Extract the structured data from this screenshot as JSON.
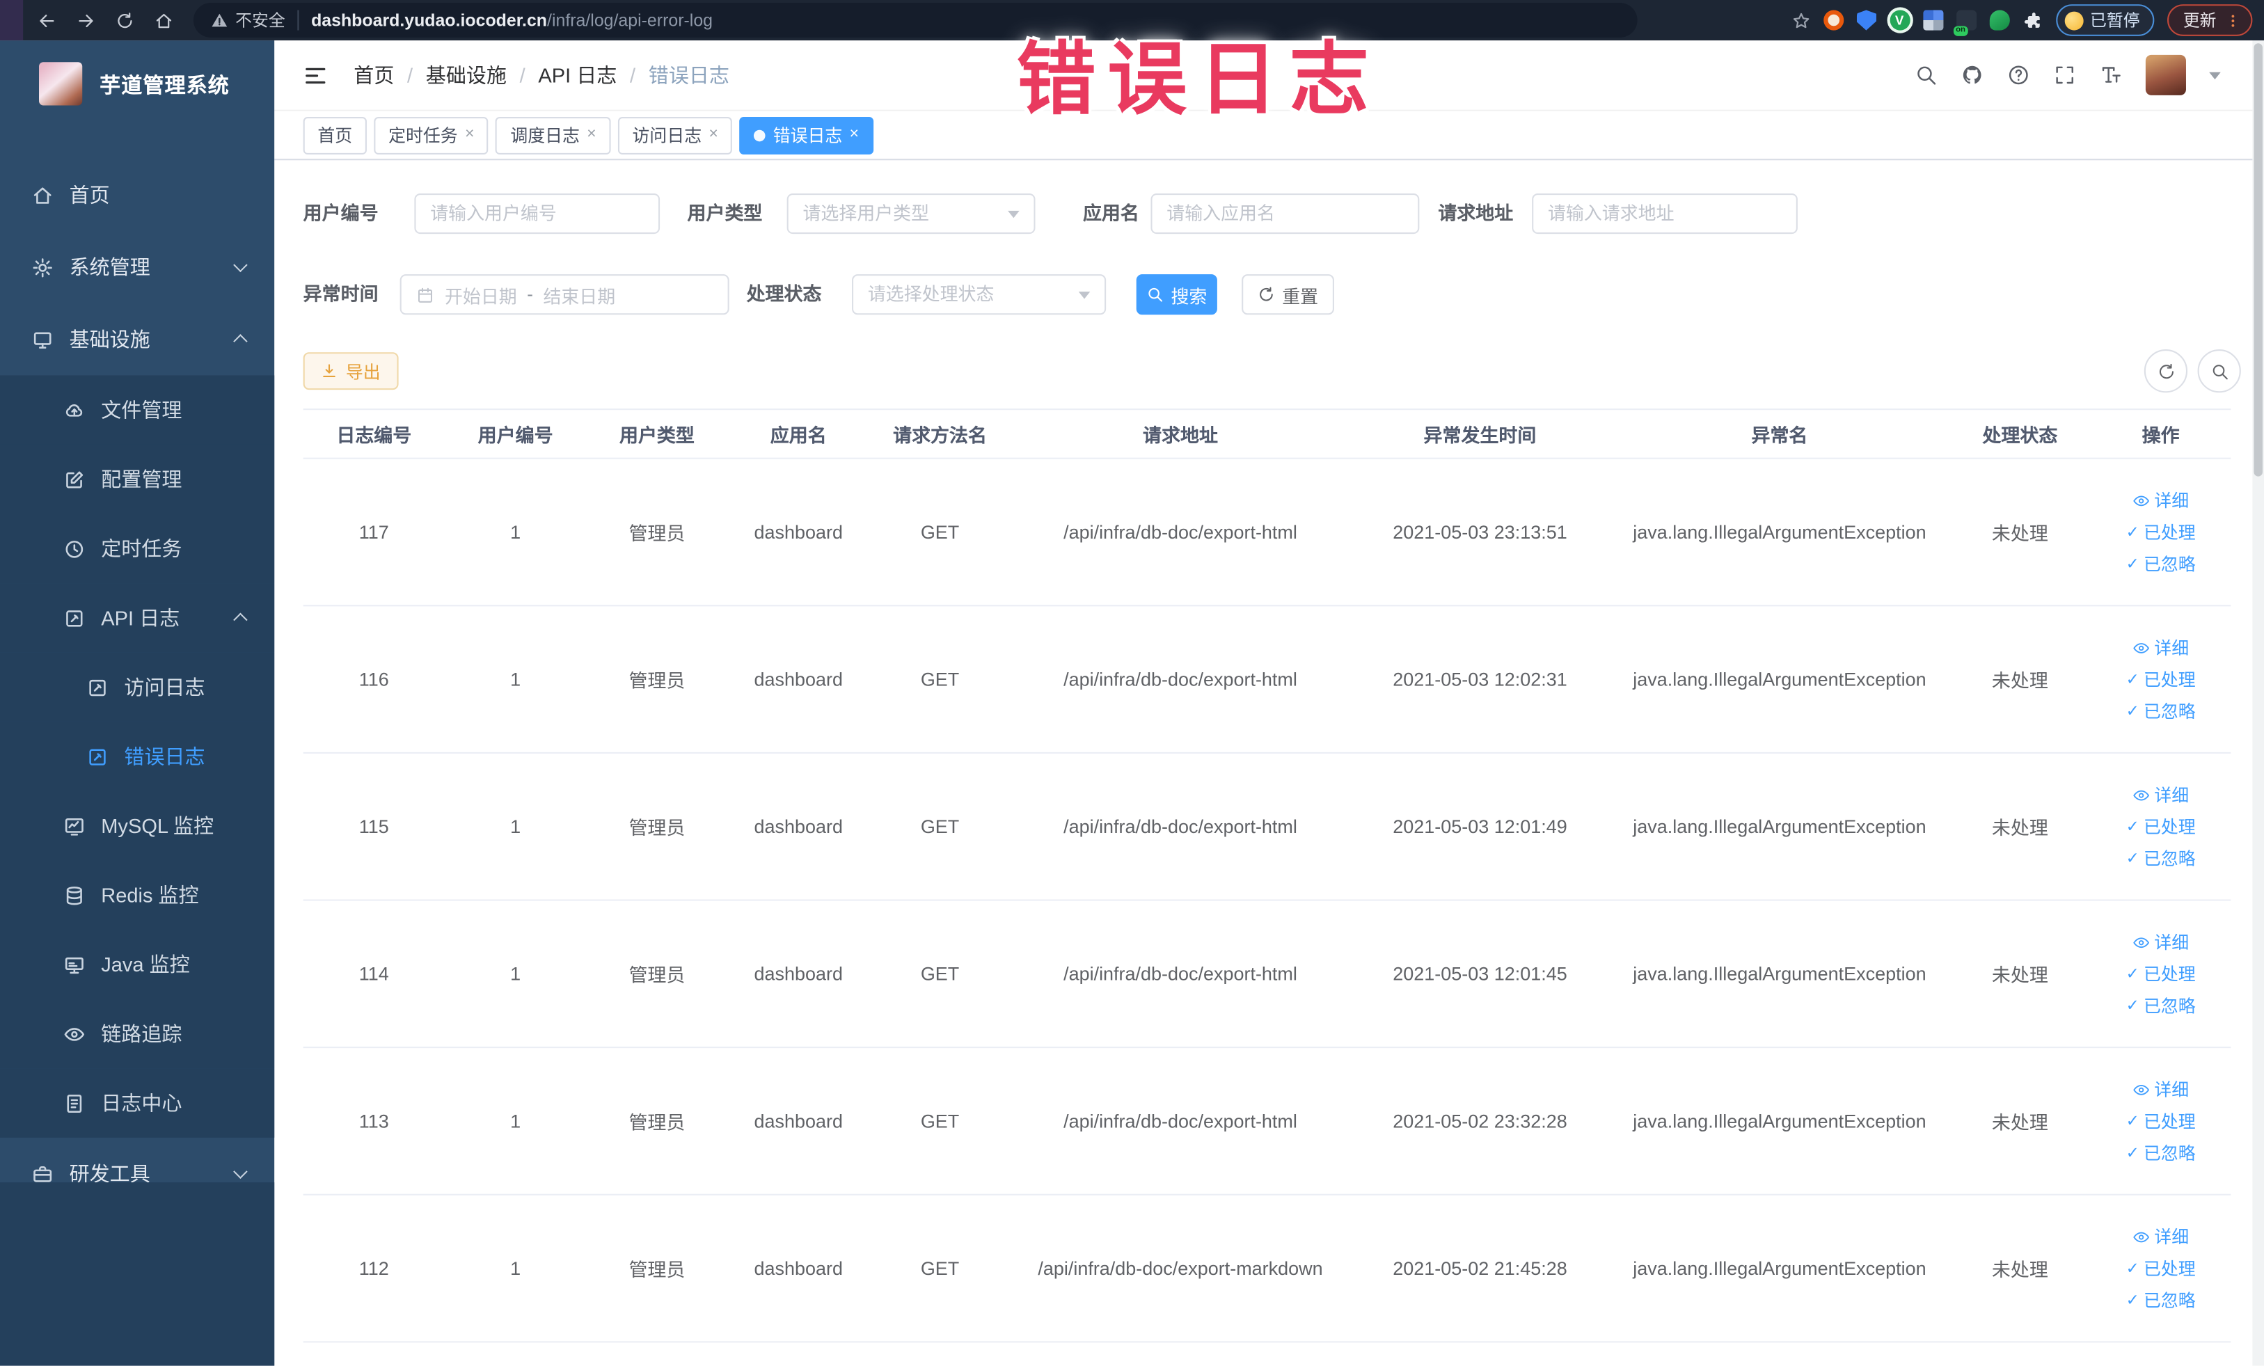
{
  "browser": {
    "security_label": "不安全",
    "url_host": "dashboard.yudao.iocoder.cn",
    "url_path": "/infra/log/api-error-log",
    "paused_badge": "已暂停",
    "update_button": "更新"
  },
  "watermark": "错误日志",
  "sidebar": {
    "app_title": "芋道管理系统",
    "items": [
      {
        "label": "首页"
      },
      {
        "label": "系统管理"
      },
      {
        "label": "基础设施"
      },
      {
        "label": "文件管理"
      },
      {
        "label": "配置管理"
      },
      {
        "label": "定时任务"
      },
      {
        "label": "API 日志"
      },
      {
        "label": "访问日志"
      },
      {
        "label": "错误日志"
      },
      {
        "label": "MySQL 监控"
      },
      {
        "label": "Redis 监控"
      },
      {
        "label": "Java 监控"
      },
      {
        "label": "链路追踪"
      },
      {
        "label": "日志中心"
      },
      {
        "label": "研发工具"
      }
    ]
  },
  "breadcrumb": [
    "首页",
    "基础设施",
    "API 日志",
    "错误日志"
  ],
  "tabs": [
    {
      "label": "首页"
    },
    {
      "label": "定时任务"
    },
    {
      "label": "调度日志"
    },
    {
      "label": "访问日志"
    },
    {
      "label": "错误日志"
    }
  ],
  "filters": {
    "user_id": {
      "label": "用户编号",
      "placeholder": "请输入用户编号"
    },
    "user_type": {
      "label": "用户类型",
      "placeholder": "请选择用户类型"
    },
    "app_name": {
      "label": "应用名",
      "placeholder": "请输入应用名"
    },
    "request_url": {
      "label": "请求地址",
      "placeholder": "请输入请求地址"
    },
    "exception_time": {
      "label": "异常时间",
      "start_placeholder": "开始日期",
      "separator": "-",
      "end_placeholder": "结束日期"
    },
    "process_status": {
      "label": "处理状态",
      "placeholder": "请选择处理状态"
    },
    "search_label": "搜索",
    "reset_label": "重置"
  },
  "toolbar": {
    "export_label": "导出"
  },
  "table": {
    "columns": [
      "日志编号",
      "用户编号",
      "用户类型",
      "应用名",
      "请求方法名",
      "请求地址",
      "异常发生时间",
      "异常名",
      "处理状态",
      "操作"
    ],
    "actions": {
      "detail": "详细",
      "processed": "已处理",
      "ignored": "已忽略"
    },
    "rows": [
      {
        "id": "117",
        "user_id": "1",
        "user_type": "管理员",
        "app_name": "dashboard",
        "method": "GET",
        "url": "/api/infra/db-doc/export-html",
        "time": "2021-05-03 23:13:51",
        "exception": "java.lang.IllegalArgumentException",
        "status": "未处理"
      },
      {
        "id": "116",
        "user_id": "1",
        "user_type": "管理员",
        "app_name": "dashboard",
        "method": "GET",
        "url": "/api/infra/db-doc/export-html",
        "time": "2021-05-03 12:02:31",
        "exception": "java.lang.IllegalArgumentException",
        "status": "未处理"
      },
      {
        "id": "115",
        "user_id": "1",
        "user_type": "管理员",
        "app_name": "dashboard",
        "method": "GET",
        "url": "/api/infra/db-doc/export-html",
        "time": "2021-05-03 12:01:49",
        "exception": "java.lang.IllegalArgumentException",
        "status": "未处理"
      },
      {
        "id": "114",
        "user_id": "1",
        "user_type": "管理员",
        "app_name": "dashboard",
        "method": "GET",
        "url": "/api/infra/db-doc/export-html",
        "time": "2021-05-03 12:01:45",
        "exception": "java.lang.IllegalArgumentException",
        "status": "未处理"
      },
      {
        "id": "113",
        "user_id": "1",
        "user_type": "管理员",
        "app_name": "dashboard",
        "method": "GET",
        "url": "/api/infra/db-doc/export-html",
        "time": "2021-05-02 23:32:28",
        "exception": "java.lang.IllegalArgumentException",
        "status": "未处理"
      },
      {
        "id": "112",
        "user_id": "1",
        "user_type": "管理员",
        "app_name": "dashboard",
        "method": "GET",
        "url": "/api/infra/db-doc/export-markdown",
        "time": "2021-05-02 21:45:28",
        "exception": "java.lang.IllegalArgumentException",
        "status": "未处理"
      }
    ]
  },
  "colors": {
    "primary": "#409eff",
    "warning": "#e6a23c",
    "watermark_red": "#e93a5f",
    "sidebar_bg": "#2d4c6b",
    "sidebar_submenu_bg": "#24405c"
  }
}
